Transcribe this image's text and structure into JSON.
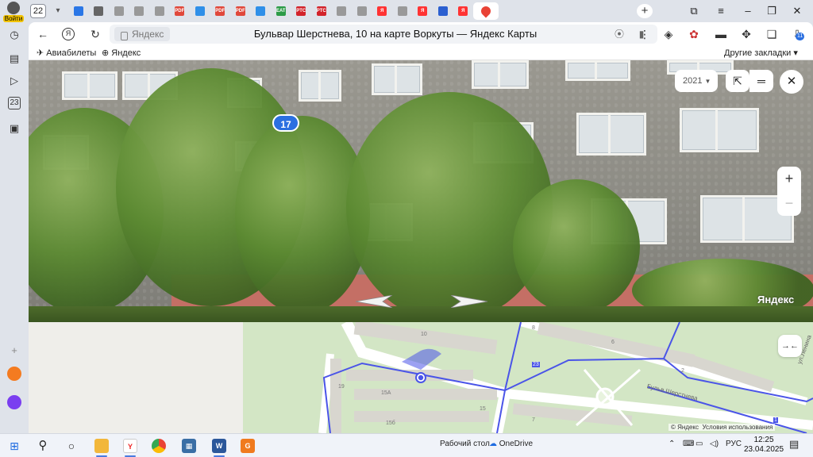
{
  "browser": {
    "login_label": "Войти",
    "tab_count": "22",
    "tabs": [
      {
        "icon": "cloud-icon",
        "color": "#2b77e6",
        "text": ""
      },
      {
        "icon": "doc-icon",
        "color": "#666666",
        "text": ""
      },
      {
        "icon": "page-icon",
        "color": "#999999",
        "text": ""
      },
      {
        "icon": "page-icon",
        "color": "#999999",
        "text": ""
      },
      {
        "icon": "page-icon",
        "color": "#999999",
        "text": ""
      },
      {
        "icon": "pdf-icon",
        "color": "#e0483b",
        "text": "PDF"
      },
      {
        "icon": "mail-icon",
        "color": "#2f8fe8",
        "text": ""
      },
      {
        "icon": "pdf-icon",
        "color": "#e0483b",
        "text": "PDF"
      },
      {
        "icon": "pdf-icon",
        "color": "#e0483b",
        "text": "PDF"
      },
      {
        "icon": "mail-icon",
        "color": "#2f8fe8",
        "text": ""
      },
      {
        "icon": "eat-icon",
        "color": "#2c9b47",
        "text": "EAT"
      },
      {
        "icon": "rts-icon",
        "color": "#d2232a",
        "text": "РТС"
      },
      {
        "icon": "rts-icon",
        "color": "#d2232a",
        "text": "РТС"
      },
      {
        "icon": "page-icon",
        "color": "#999999",
        "text": ""
      },
      {
        "icon": "page-icon",
        "color": "#999999",
        "text": ""
      },
      {
        "icon": "yandex-icon",
        "color": "#f33",
        "text": "Я"
      },
      {
        "icon": "page-icon",
        "color": "#999999",
        "text": ""
      },
      {
        "icon": "yandex-icon",
        "color": "#f33",
        "text": "Я"
      },
      {
        "icon": "gem-icon",
        "color": "#2b5fd0",
        "text": ""
      },
      {
        "icon": "yandex-icon",
        "color": "#f33",
        "text": "Я"
      },
      {
        "icon": "maps-pin-icon",
        "color": "#e94235",
        "text": "",
        "active": true
      }
    ],
    "address": {
      "host": "Яндекс",
      "title": "Бульвар Шерстнева, 10 на карте Воркуты — Яндекс Карты"
    },
    "extension_badge": "11",
    "bookmarks": [
      {
        "label": "Авиабилеты",
        "icon": "plane-icon"
      },
      {
        "label": "Яндекс",
        "icon": "plus-circle-icon"
      }
    ],
    "other_bookmarks": "Другие закладки"
  },
  "panorama": {
    "year": "2021",
    "house_number": "17",
    "watermark": "Яндекс"
  },
  "map": {
    "labels": [
      "10",
      "8",
      "6",
      "2",
      "19",
      "15А",
      "15",
      "15б",
      "7",
      "23",
      "1"
    ],
    "street_shesterneva": "Бульв.Шерстнева",
    "street_lenina": "ул.Ленина",
    "copyright": "© Яндекс",
    "terms": "Условия использования"
  },
  "taskbar": {
    "desktop_label": "Рабочий стол",
    "onedrive_label": "OneDrive",
    "lang": "РУС",
    "time": "12:25",
    "date": "23.04.2025"
  }
}
